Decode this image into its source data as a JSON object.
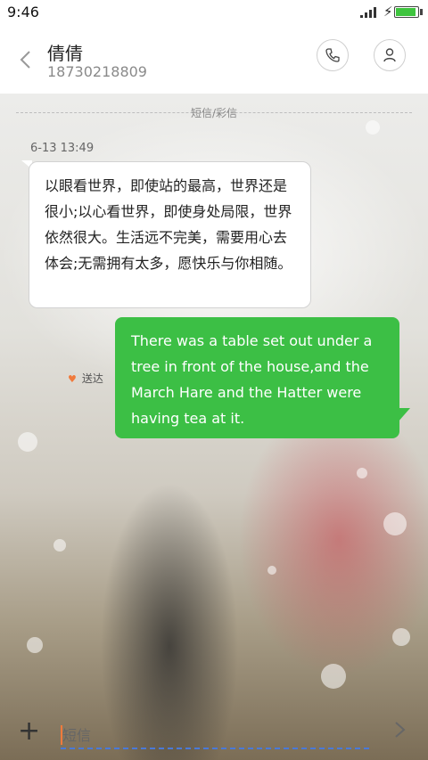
{
  "status_bar": {
    "time": "9:46"
  },
  "header": {
    "contact_name": "倩倩",
    "contact_number": "18730218809"
  },
  "conversation": {
    "type_label": "短信/彩信",
    "timestamp": "6-13 13:49",
    "incoming_message": "以眼看世界，即使站的最高，世界还是很小;以心看世界，即使身处局限，世界依然很大。生活远不完美，需要用心去体会;无需拥有太多，愿快乐与你相随。",
    "outgoing_message": "There was a table set out under a tree in front of the house,and the March Hare and the Hatter were having tea at it.",
    "delivery_status": "送达"
  },
  "composer": {
    "plus_label": "+",
    "placeholder": "短信"
  },
  "colors": {
    "outgoing_bubble": "#3cbf45",
    "accent": "#f07a3c",
    "battery": "#3ec43e"
  },
  "icons": [
    "back-arrow-icon",
    "phone-icon",
    "person-icon",
    "heart-icon",
    "send-arrow-icon"
  ]
}
